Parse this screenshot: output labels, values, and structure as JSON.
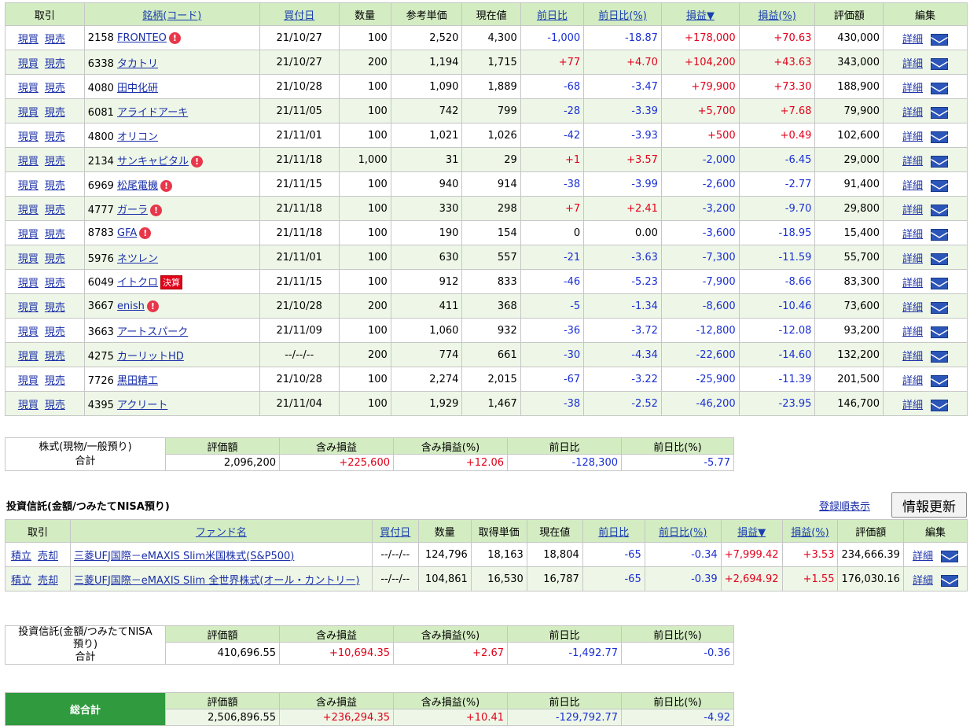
{
  "stocks": {
    "headers": [
      "取引",
      "銘柄(コード)",
      "買付日",
      "数量",
      "参考単価",
      "現在値",
      "前日比",
      "前日比(%)",
      "損益▼",
      "損益(%)",
      "評価額",
      "編集"
    ],
    "buy_label": "現買",
    "sell_label": "現売",
    "detail_label": "詳細",
    "kessan_label": "決算",
    "rows": [
      {
        "code": "2158",
        "name": "FRONTEO",
        "warn": true,
        "kessan": false,
        "date": "21/10/27",
        "qty": "100",
        "ref": "2,520",
        "cur": "4,300",
        "chg": "-1,000",
        "chgp": "-18.87",
        "pl": "+178,000",
        "plp": "+70.63",
        "val": "430,000"
      },
      {
        "code": "6338",
        "name": "タカトリ",
        "warn": false,
        "kessan": false,
        "date": "21/10/27",
        "qty": "200",
        "ref": "1,194",
        "cur": "1,715",
        "chg": "+77",
        "chgp": "+4.70",
        "pl": "+104,200",
        "plp": "+43.63",
        "val": "343,000"
      },
      {
        "code": "4080",
        "name": "田中化研",
        "warn": false,
        "kessan": false,
        "date": "21/10/28",
        "qty": "100",
        "ref": "1,090",
        "cur": "1,889",
        "chg": "-68",
        "chgp": "-3.47",
        "pl": "+79,900",
        "plp": "+73.30",
        "val": "188,900"
      },
      {
        "code": "6081",
        "name": "アライドアーキ",
        "warn": false,
        "kessan": false,
        "date": "21/11/05",
        "qty": "100",
        "ref": "742",
        "cur": "799",
        "chg": "-28",
        "chgp": "-3.39",
        "pl": "+5,700",
        "plp": "+7.68",
        "val": "79,900"
      },
      {
        "code": "4800",
        "name": "オリコン",
        "warn": false,
        "kessan": false,
        "date": "21/11/01",
        "qty": "100",
        "ref": "1,021",
        "cur": "1,026",
        "chg": "-42",
        "chgp": "-3.93",
        "pl": "+500",
        "plp": "+0.49",
        "val": "102,600"
      },
      {
        "code": "2134",
        "name": "サンキャピタル",
        "warn": true,
        "kessan": false,
        "date": "21/11/18",
        "qty": "1,000",
        "ref": "31",
        "cur": "29",
        "chg": "+1",
        "chgp": "+3.57",
        "pl": "-2,000",
        "plp": "-6.45",
        "val": "29,000"
      },
      {
        "code": "6969",
        "name": "松尾電機",
        "warn": true,
        "kessan": false,
        "date": "21/11/15",
        "qty": "100",
        "ref": "940",
        "cur": "914",
        "chg": "-38",
        "chgp": "-3.99",
        "pl": "-2,600",
        "plp": "-2.77",
        "val": "91,400"
      },
      {
        "code": "4777",
        "name": "ガーラ",
        "warn": true,
        "kessan": false,
        "date": "21/11/18",
        "qty": "100",
        "ref": "330",
        "cur": "298",
        "chg": "+7",
        "chgp": "+2.41",
        "pl": "-3,200",
        "plp": "-9.70",
        "val": "29,800"
      },
      {
        "code": "8783",
        "name": "GFA",
        "warn": true,
        "kessan": false,
        "date": "21/11/18",
        "qty": "100",
        "ref": "190",
        "cur": "154",
        "chg": "0",
        "chgp": "0.00",
        "pl": "-3,600",
        "plp": "-18.95",
        "val": "15,400"
      },
      {
        "code": "5976",
        "name": "ネツレン",
        "warn": false,
        "kessan": false,
        "date": "21/11/01",
        "qty": "100",
        "ref": "630",
        "cur": "557",
        "chg": "-21",
        "chgp": "-3.63",
        "pl": "-7,300",
        "plp": "-11.59",
        "val": "55,700"
      },
      {
        "code": "6049",
        "name": "イトクロ",
        "warn": false,
        "kessan": true,
        "date": "21/11/15",
        "qty": "100",
        "ref": "912",
        "cur": "833",
        "chg": "-46",
        "chgp": "-5.23",
        "pl": "-7,900",
        "plp": "-8.66",
        "val": "83,300"
      },
      {
        "code": "3667",
        "name": "enish",
        "warn": true,
        "kessan": false,
        "date": "21/10/28",
        "qty": "200",
        "ref": "411",
        "cur": "368",
        "chg": "-5",
        "chgp": "-1.34",
        "pl": "-8,600",
        "plp": "-10.46",
        "val": "73,600"
      },
      {
        "code": "3663",
        "name": "アートスパーク",
        "warn": false,
        "kessan": false,
        "date": "21/11/09",
        "qty": "100",
        "ref": "1,060",
        "cur": "932",
        "chg": "-36",
        "chgp": "-3.72",
        "pl": "-12,800",
        "plp": "-12.08",
        "val": "93,200"
      },
      {
        "code": "4275",
        "name": "カーリットHD",
        "warn": false,
        "kessan": false,
        "date": "--/--/--",
        "qty": "200",
        "ref": "774",
        "cur": "661",
        "chg": "-30",
        "chgp": "-4.34",
        "pl": "-22,600",
        "plp": "-14.60",
        "val": "132,200"
      },
      {
        "code": "7726",
        "name": "黒田精工",
        "warn": false,
        "kessan": false,
        "date": "21/10/28",
        "qty": "100",
        "ref": "2,274",
        "cur": "2,015",
        "chg": "-67",
        "chgp": "-3.22",
        "pl": "-25,900",
        "plp": "-11.39",
        "val": "201,500"
      },
      {
        "code": "4395",
        "name": "アクリート",
        "warn": false,
        "kessan": false,
        "date": "21/11/04",
        "qty": "100",
        "ref": "1,929",
        "cur": "1,467",
        "chg": "-38",
        "chgp": "-2.52",
        "pl": "-46,200",
        "plp": "-23.95",
        "val": "146,700"
      }
    ]
  },
  "stock_summary": {
    "label_line1": "株式(現物/一般預り)",
    "label_line2": "合計",
    "headers": [
      "評価額",
      "含み損益",
      "含み損益(%)",
      "前日比",
      "前日比(%)"
    ],
    "values": [
      "2,096,200",
      "+225,600",
      "+12.06",
      "-128,300",
      "-5.77"
    ]
  },
  "funds": {
    "title": "投資信託(金額/つみたてNISA預り)",
    "order_link": "登録順表示",
    "refresh_button": "情報更新",
    "headers": [
      "取引",
      "ファンド名",
      "買付日",
      "数量",
      "取得単価",
      "現在値",
      "前日比",
      "前日比(%)",
      "損益▼",
      "損益(%)",
      "評価額",
      "編集"
    ],
    "buy_label": "積立",
    "sell_label": "売却",
    "detail_label": "詳細",
    "rows": [
      {
        "name": "三菱UFJ国際－eMAXIS Slim米国株式(S&P500)",
        "date": "--/--/--",
        "qty": "124,796",
        "ref": "18,163",
        "cur": "18,804",
        "chg": "-65",
        "chgp": "-0.34",
        "pl": "+7,999.42",
        "plp": "+3.53",
        "val": "234,666.39"
      },
      {
        "name": "三菱UFJ国際－eMAXIS Slim 全世界株式(オール・カントリー)",
        "date": "--/--/--",
        "qty": "104,861",
        "ref": "16,530",
        "cur": "16,787",
        "chg": "-65",
        "chgp": "-0.39",
        "pl": "+2,694.92",
        "plp": "+1.55",
        "val": "176,030.16"
      }
    ]
  },
  "fund_summary": {
    "label_line1": "投資信託(金額/つみたてNISA",
    "label_line2": "預り)",
    "label_line3": "合計",
    "headers": [
      "評価額",
      "含み損益",
      "含み損益(%)",
      "前日比",
      "前日比(%)"
    ],
    "values": [
      "410,696.55",
      "+10,694.35",
      "+2.67",
      "-1,492.77",
      "-0.36"
    ]
  },
  "grand_total": {
    "label": "総合計",
    "headers": [
      "評価額",
      "含み損益",
      "含み損益(%)",
      "前日比",
      "前日比(%)"
    ],
    "values": [
      "2,506,896.55",
      "+236,294.35",
      "+10.41",
      "-129,792.77",
      "-4.92"
    ]
  },
  "colors": {
    "header_bg": "#d3ecc2",
    "stripe_bg": "#eef7e7",
    "positive": "#e2001a",
    "negative": "#1a2fd4",
    "total_bg": "#2f9a3e"
  }
}
